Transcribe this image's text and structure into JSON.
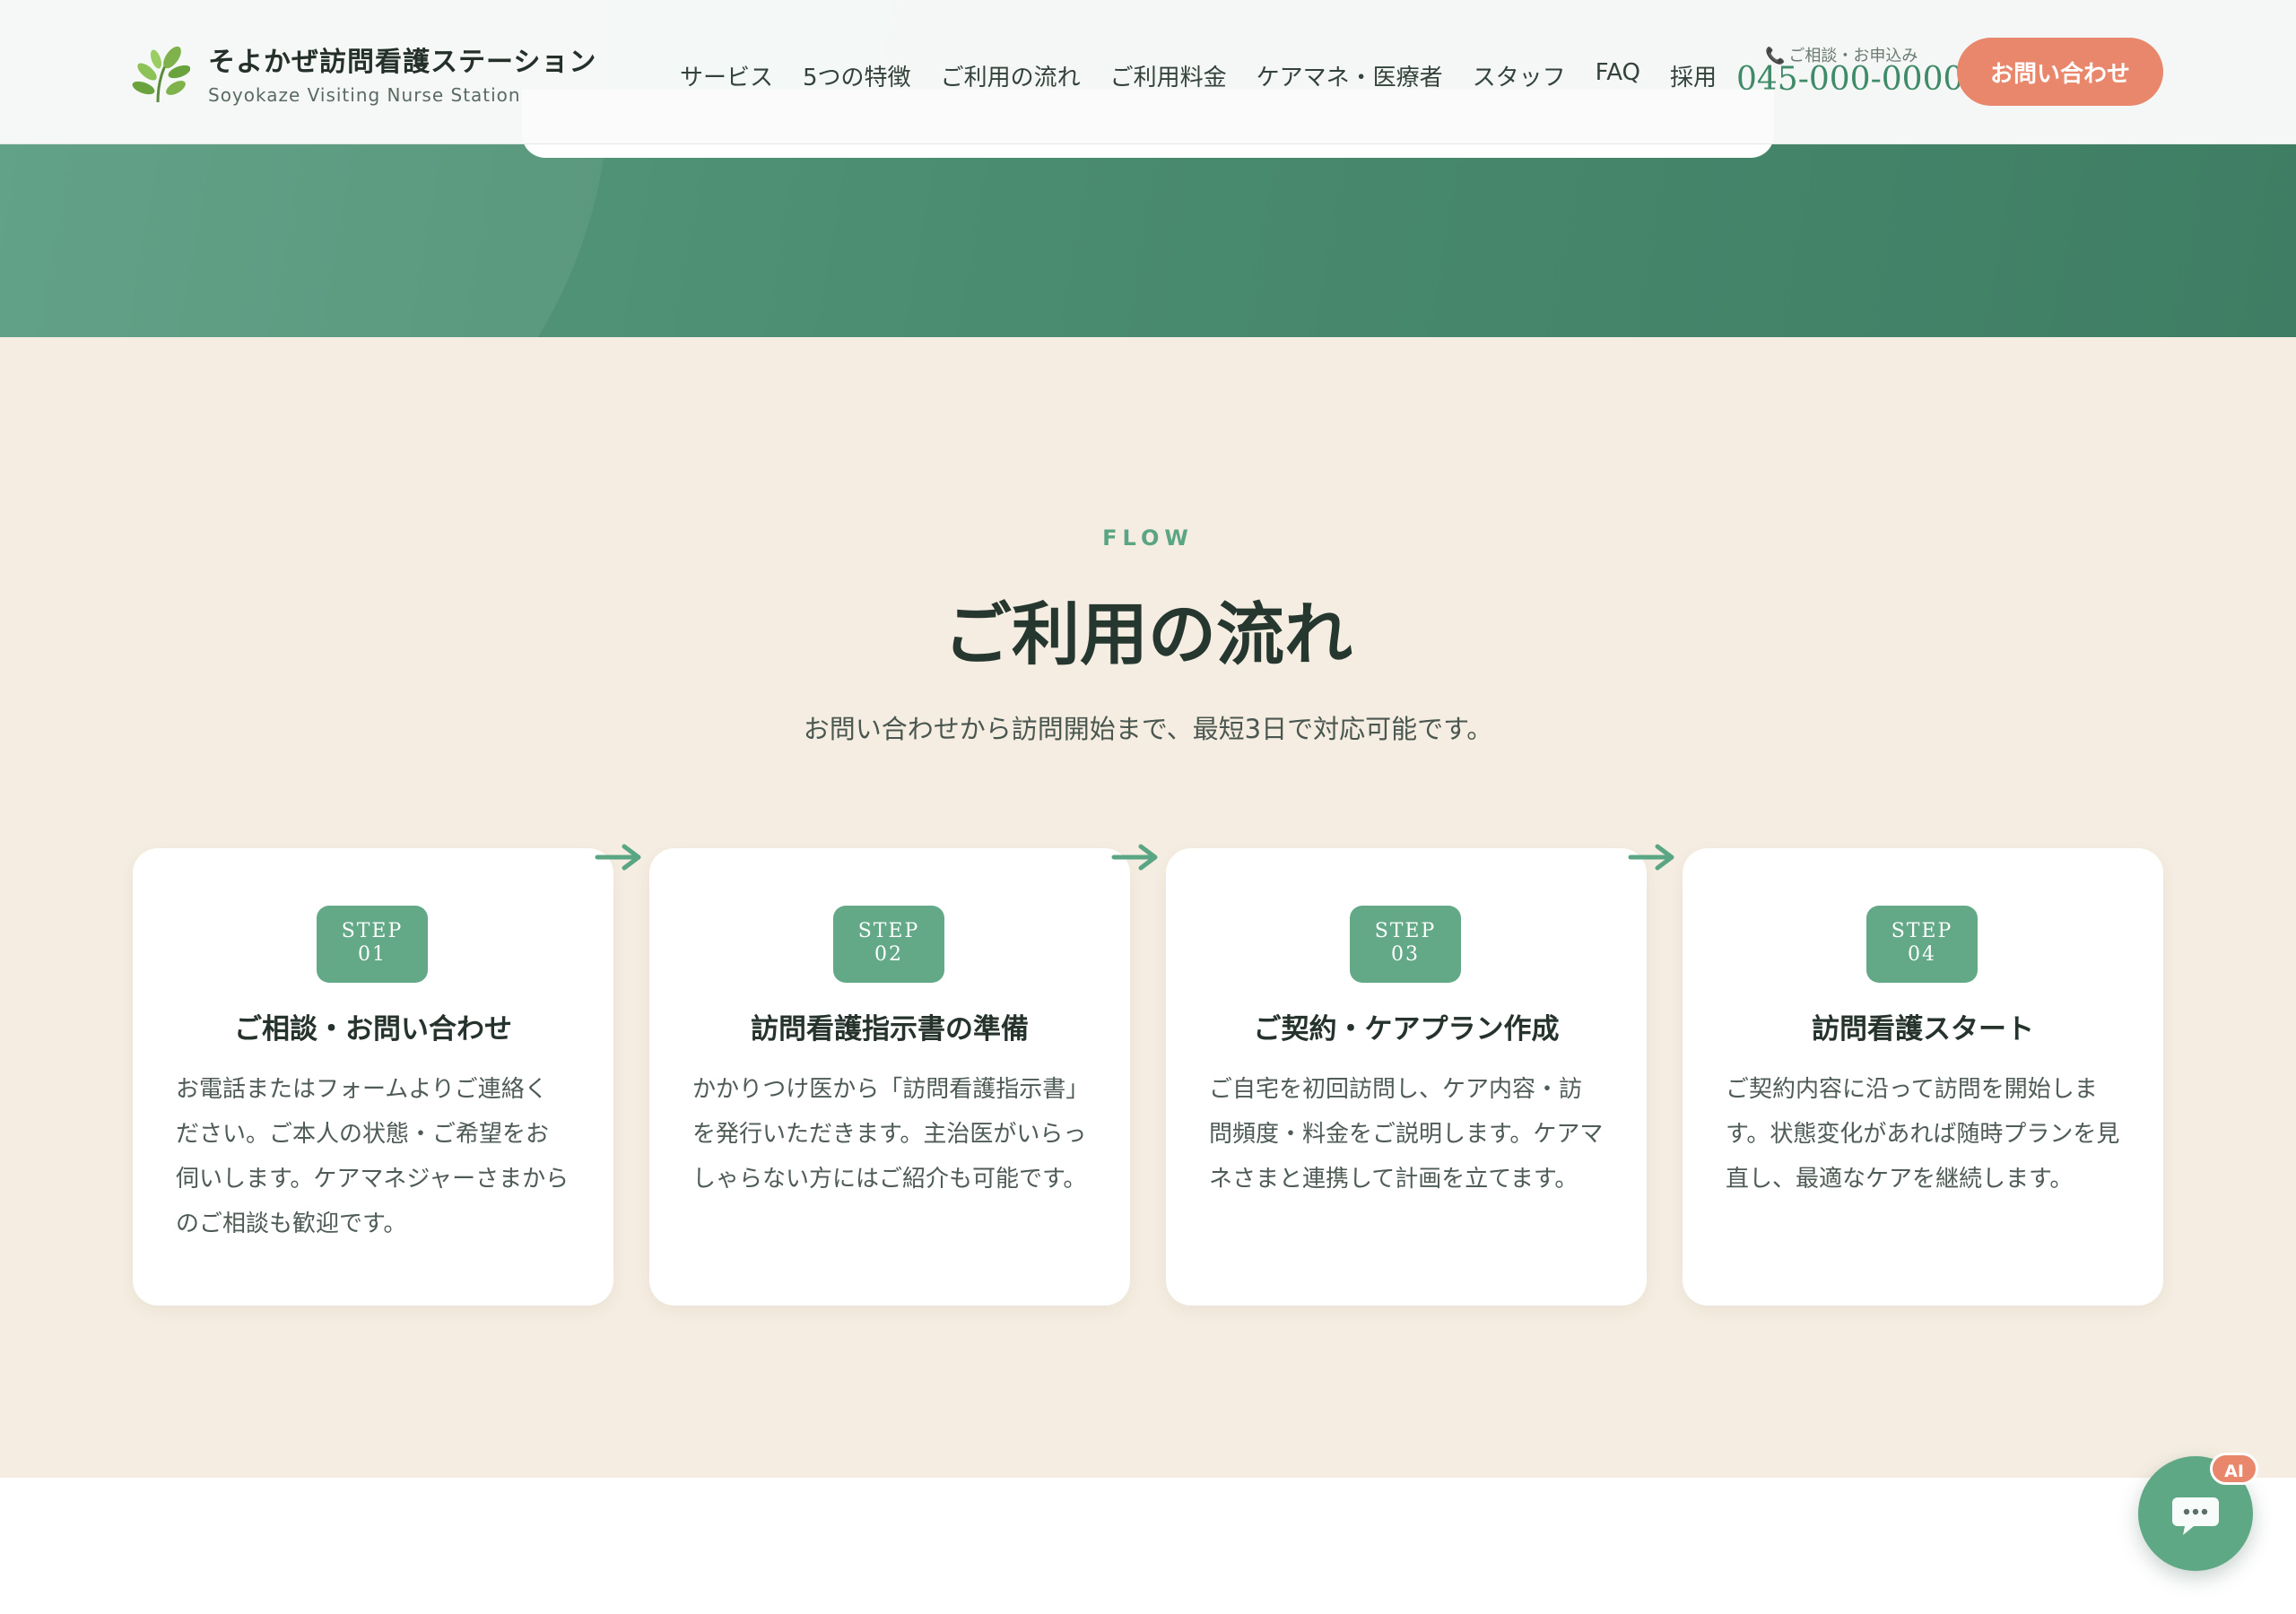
{
  "header": {
    "logo_name": "そよかぜ訪問看護ステーション",
    "logo_sub": "Soyokaze Visiting Nurse Station",
    "nav": [
      "サービス",
      "5つの特徴",
      "ご利用の流れ",
      "ご利用料金",
      "ケアマネ・医療者",
      "スタッフ",
      "FAQ",
      "採用"
    ],
    "tel_label": "ご相談・お申込み",
    "tel_number": "045-000-0000",
    "cta_label": "お問い合わせ"
  },
  "flow": {
    "eyebrow": "FLOW",
    "title": "ご利用の流れ",
    "lead": "お問い合わせから訪問開始まで、最短3日で対応可能です。",
    "steps": [
      {
        "step_label": "STEP",
        "step_num": "01",
        "title": "ご相談・お問い合わせ",
        "text": "お電話またはフォームよりご連絡ください。ご本人の状態・ご希望をお伺いします。ケアマネジャーさまからのご相談も歓迎です。"
      },
      {
        "step_label": "STEP",
        "step_num": "02",
        "title": "訪問看護指示書の準備",
        "text": "かかりつけ医から「訪問看護指示書」を発行いただきます。主治医がいらっしゃらない方にはご紹介も可能です。"
      },
      {
        "step_label": "STEP",
        "step_num": "03",
        "title": "ご契約・ケアプラン作成",
        "text": "ご自宅を初回訪問し、ケア内容・訪問頻度・料金をご説明します。ケアマネさまと連携して計画を立てます。"
      },
      {
        "step_label": "STEP",
        "step_num": "04",
        "title": "訪問看護スタート",
        "text": "ご契約内容に沿って訪問を開始します。状態変化があれば随時プランを見直し、最適なケアを継続します。"
      }
    ]
  },
  "chat": {
    "badge": "AI",
    "icon": "chat-bubble-icon"
  },
  "colors": {
    "brand_green": "#5fa886",
    "accent_coral": "#e8876b",
    "section_bg": "#f5ede1"
  }
}
